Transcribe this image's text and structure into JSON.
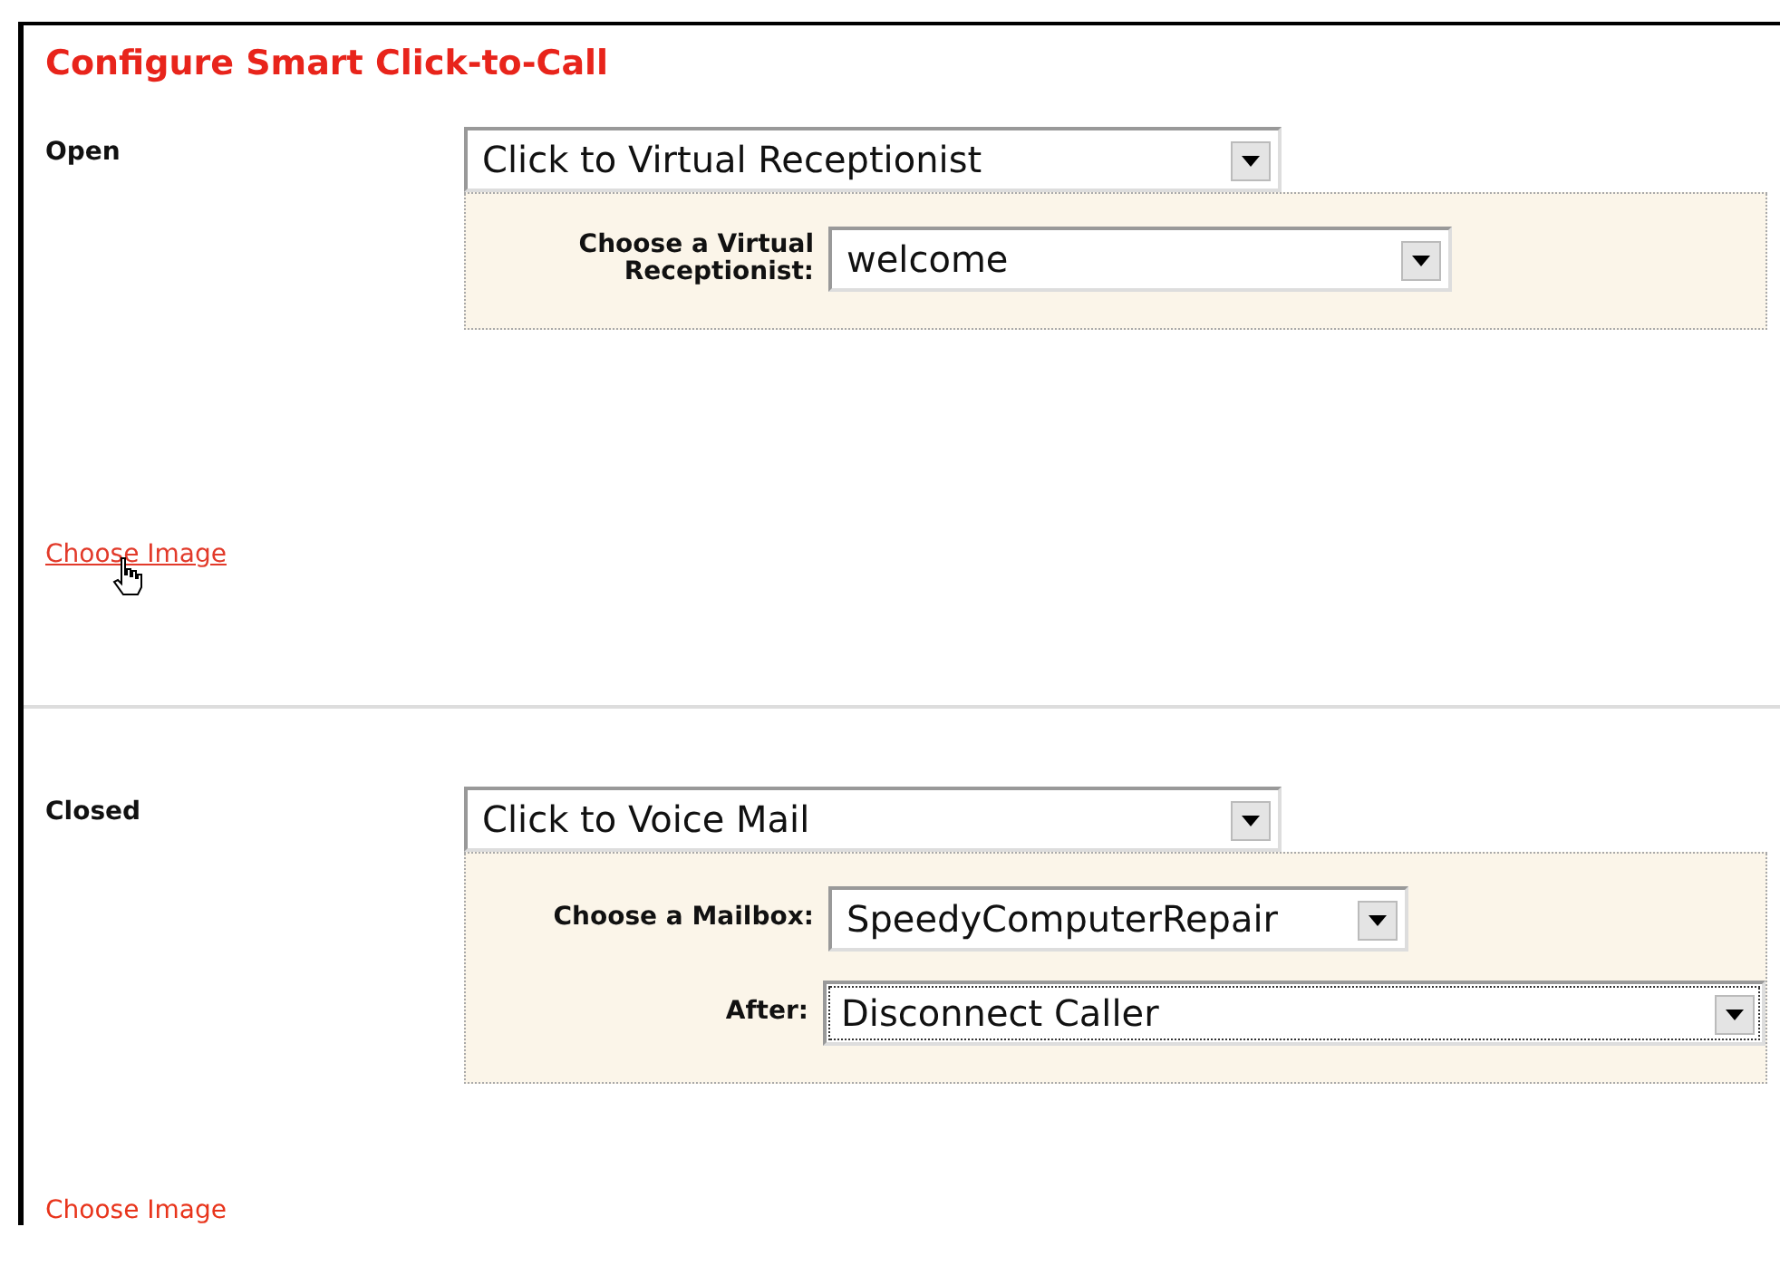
{
  "title": "Configure Smart Click-to-Call",
  "sections": [
    {
      "label": "Open",
      "action": {
        "value": "Click to Virtual Receptionist",
        "focused": false
      },
      "fields": [
        {
          "label": "Choose a Virtual Receptionist:",
          "value": "welcome",
          "focused": false
        }
      ],
      "link": {
        "text": "Choose Image",
        "hovered": true
      }
    },
    {
      "label": "Closed",
      "action": {
        "value": "Click to Voice Mail",
        "focused": false
      },
      "fields": [
        {
          "label": "Choose a Mailbox:",
          "value": "SpeedyComputerRepair",
          "focused": false
        },
        {
          "label": "After:",
          "value": "Disconnect Caller",
          "focused": true
        }
      ],
      "link": {
        "text": "Choose Image",
        "hovered": false
      }
    }
  ]
}
